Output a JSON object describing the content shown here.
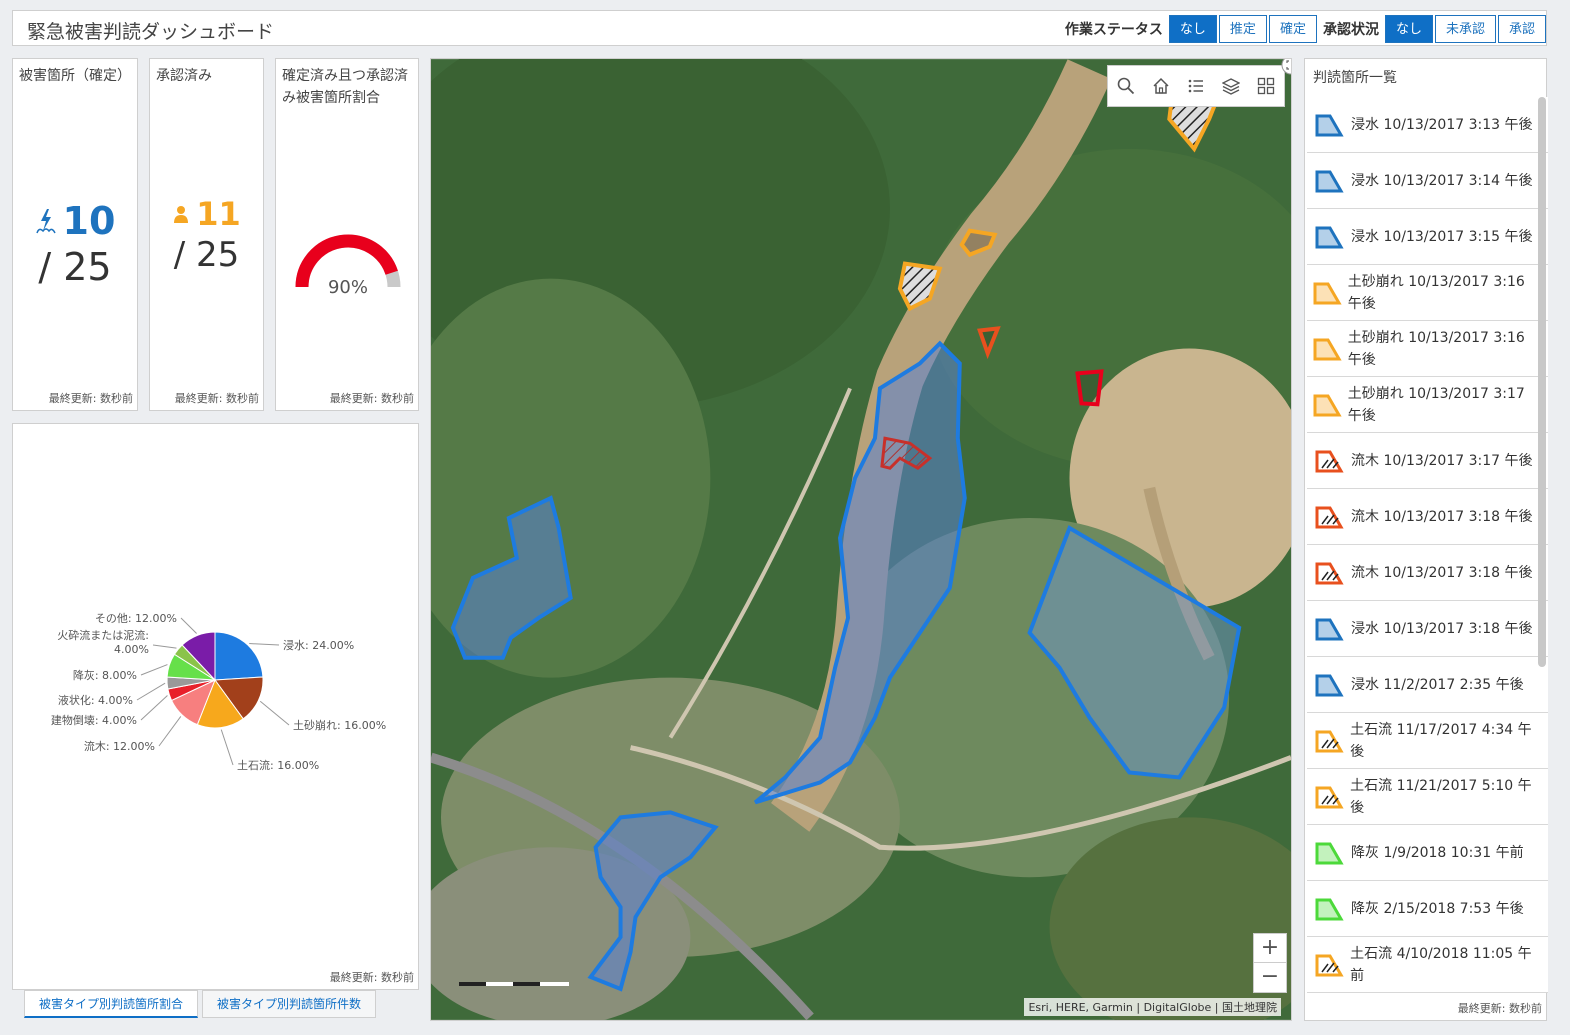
{
  "header": {
    "title": "緊急被害判読ダッシュボード",
    "work_status_label": "作業ステータス",
    "work_status_options": [
      "なし",
      "推定",
      "確定"
    ],
    "approval_label": "承認状況",
    "approval_options": [
      "なし",
      "未承認",
      "承認"
    ]
  },
  "indicators": [
    {
      "title": "被害箇所（確定）",
      "value": "10",
      "total": "/ 25",
      "footer": "最終更新: 数秒前",
      "icon": "damage-icon",
      "color": "#1e73be"
    },
    {
      "title": "承認済み",
      "value": "11",
      "total": "/ 25",
      "footer": "最終更新: 数秒前",
      "icon": "person-icon",
      "color": "#f5a623"
    },
    {
      "title": "確定済み且つ承認済み被害箇所割合",
      "gauge_value": "90%",
      "gauge_fraction": 0.9,
      "footer": "最終更新: 数秒前"
    }
  ],
  "pie_panel": {
    "footer": "最終更新: 数秒前",
    "tabs": [
      "被害タイプ別判読箇所割合",
      "被害タイプ別判読箇所件数"
    ]
  },
  "chart_data": {
    "type": "pie",
    "labels": [
      "浸水",
      "土砂崩れ",
      "土石流",
      "流木",
      "建物倒壊",
      "液状化",
      "降灰",
      "火砕流または泥流",
      "その他"
    ],
    "values": [
      24.0,
      16.0,
      16.0,
      12.0,
      4.0,
      4.0,
      8.0,
      4.0,
      12.0
    ],
    "display": [
      "浸水: 24.00%",
      "土砂崩れ: 16.00%",
      "土石流: 16.00%",
      "流木: 12.00%",
      "建物倒壊: 4.00%",
      "液状化: 4.00%",
      "降灰: 8.00%",
      "火砕流または泥流: 4.00%",
      "その他: 12.00%"
    ],
    "colors": [
      "#1e7be0",
      "#a2401b",
      "#f7a81c",
      "#f77f7f",
      "#e8202a",
      "#999999",
      "#66e04a",
      "#8bc34a",
      "#7a1ca8"
    ]
  },
  "map": {
    "attribution": "Esri, HERE, Garmin | DigitalGlobe | 国土地理院",
    "zoom_in": "+",
    "zoom_out": "−"
  },
  "list": {
    "title": "判読箇所一覧",
    "footer": "最終更新: 数秒前",
    "items": [
      {
        "text": "浸水 10/13/2017 3:13 午後",
        "kind": "flood"
      },
      {
        "text": "浸水 10/13/2017 3:14 午後",
        "kind": "flood"
      },
      {
        "text": "浸水 10/13/2017 3:15 午後",
        "kind": "flood"
      },
      {
        "text": "土砂崩れ 10/13/2017 3:16 午後",
        "kind": "landslide"
      },
      {
        "text": "土砂崩れ 10/13/2017 3:16 午後",
        "kind": "landslide"
      },
      {
        "text": "土砂崩れ 10/13/2017 3:17 午後",
        "kind": "landslide"
      },
      {
        "text": "流木 10/13/2017 3:17 午後",
        "kind": "driftwood"
      },
      {
        "text": "流木 10/13/2017 3:18 午後",
        "kind": "driftwood"
      },
      {
        "text": "流木 10/13/2017 3:18 午後",
        "kind": "driftwood"
      },
      {
        "text": "浸水 10/13/2017 3:18 午後",
        "kind": "flood"
      },
      {
        "text": "浸水 11/2/2017 2:35 午後",
        "kind": "flood"
      },
      {
        "text": "土石流 11/17/2017 4:34 午後",
        "kind": "debris"
      },
      {
        "text": "土石流 11/21/2017 5:10 午後",
        "kind": "debris"
      },
      {
        "text": "降灰 1/9/2018 10:31 午前",
        "kind": "ash"
      },
      {
        "text": "降灰 2/15/2018 7:53 午後",
        "kind": "ash"
      },
      {
        "text": "土石流 4/10/2018 11:05 午前",
        "kind": "debris"
      }
    ]
  },
  "colors": {
    "accent": "#0f6fc6",
    "flood": "#1e73be",
    "landslide": "#f5a623",
    "driftwood": "#e8501e",
    "debris": "#f5a623",
    "ash": "#4cd93a",
    "gauge": "#e8001c"
  }
}
